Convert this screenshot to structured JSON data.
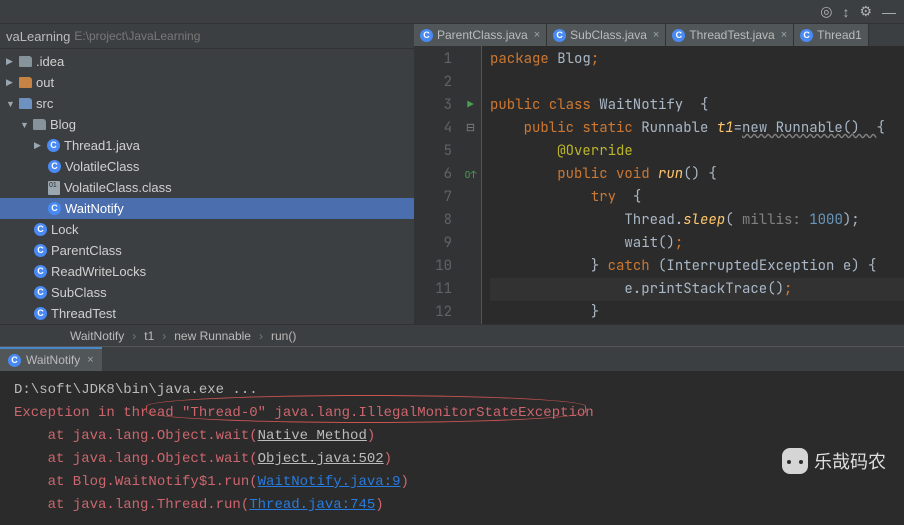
{
  "project": {
    "name": "vaLearning",
    "path": "E:\\project\\JavaLearning"
  },
  "tree": {
    "idea": ".idea",
    "out": "out",
    "src": "src",
    "blog": "Blog",
    "thread1": "Thread1.java",
    "volatileClass": "VolatileClass",
    "volatileClassFile": "VolatileClass.class",
    "waitNotify": "WaitNotify",
    "lock": "Lock",
    "parentClass": "ParentClass",
    "readWriteLocks": "ReadWriteLocks",
    "subClass": "SubClass",
    "threadTest": "ThreadTest"
  },
  "tabs": {
    "t1": "ParentClass.java",
    "t2": "SubClass.java",
    "t3": "ThreadTest.java",
    "t4": "Thread1"
  },
  "breadcrumb": {
    "c1": "WaitNotify",
    "c2": "t1",
    "c3": "new Runnable",
    "c4": "run()"
  },
  "code": {
    "l1": {
      "a": "package",
      "b": " Blog",
      "c": ";"
    },
    "l3": {
      "a": "public class",
      "b": " WaitNotify  {"
    },
    "l4": {
      "a": "public static",
      "b": " Runnable ",
      "c": "t1",
      "d": "=",
      "e": "new Runnable()  ",
      "f": "{"
    },
    "l5": "@Override",
    "l6": {
      "a": "public void",
      "b": " run",
      "c": "() {"
    },
    "l7": {
      "a": "try",
      "b": "  {"
    },
    "l8": {
      "a": "Thread.",
      "b": "sleep",
      "c": "( ",
      "d": "millis:",
      "e": " 1000",
      "f": ");"
    },
    "l9": {
      "a": "wait()",
      "b": ";"
    },
    "l10": {
      "a": "} ",
      "b": "catch",
      "c": " (InterruptedException e) {"
    },
    "l11": {
      "a": "e.printStackTrace()",
      "b": ";"
    },
    "l12": "}"
  },
  "console": {
    "tab": "WaitNotify",
    "cmd": "D:\\soft\\JDK8\\bin\\java.exe ...",
    "exc": "Exception in thread \"Thread-0\" java.lang.IllegalMonitorStateException",
    "s1": {
      "a": "    at java.lang.Object.wait(",
      "b": "Native Method",
      "c": ")"
    },
    "s2": {
      "a": "    at java.lang.Object.wait(",
      "b": "Object.java:502",
      "c": ")"
    },
    "s3": {
      "a": "    at Blog.WaitNotify$1.run(",
      "b": "WaitNotify.java:9",
      "c": ")"
    },
    "s4": {
      "a": "    at java.lang.Thread.run(",
      "b": "Thread.java:745",
      "c": ")"
    }
  },
  "watermark": "乐哉码农"
}
